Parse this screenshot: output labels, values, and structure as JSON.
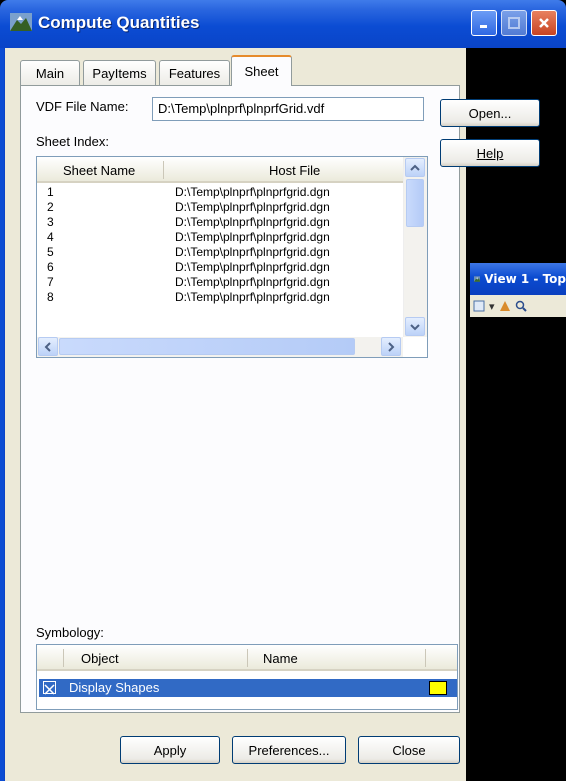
{
  "dialog": {
    "title": "Compute Quantities",
    "tabs": [
      "Main",
      "PayItems",
      "Features",
      "Sheet"
    ],
    "active_tab": "Sheet",
    "vdf_label": "VDF File Name:",
    "vdf_value": "D:\\Temp\\plnprf\\plnprfGrid.vdf",
    "open_button": "Open...",
    "help_button": "Help",
    "sheet_index_label": "Sheet Index:",
    "sheet_columns": [
      "Sheet Name",
      "Host File"
    ],
    "sheets": [
      {
        "name": "1",
        "file": "D:\\Temp\\plnprf\\plnprfgrid.dgn"
      },
      {
        "name": "2",
        "file": "D:\\Temp\\plnprf\\plnprfgrid.dgn"
      },
      {
        "name": "3",
        "file": "D:\\Temp\\plnprf\\plnprfgrid.dgn"
      },
      {
        "name": "4",
        "file": "D:\\Temp\\plnprf\\plnprfgrid.dgn"
      },
      {
        "name": "5",
        "file": "D:\\Temp\\plnprf\\plnprfgrid.dgn"
      },
      {
        "name": "6",
        "file": "D:\\Temp\\plnprf\\plnprfgrid.dgn"
      },
      {
        "name": "7",
        "file": "D:\\Temp\\plnprf\\plnprfgrid.dgn"
      },
      {
        "name": "8",
        "file": "D:\\Temp\\plnprf\\plnprfgrid.dgn"
      }
    ],
    "symbology_label": "Symbology:",
    "symbology_columns": [
      "Object",
      "Name"
    ],
    "symbology_row": {
      "object": "Display Shapes",
      "checked": true,
      "color": "#ffff00"
    },
    "buttons": {
      "apply": "Apply",
      "preferences": "Preferences...",
      "close": "Close"
    }
  },
  "background_window": {
    "title": "View 1 - Top"
  },
  "colors": {
    "titlebar": "#0b4cd3",
    "selection": "#316ac5",
    "dialog_bg": "#ece9d8"
  }
}
